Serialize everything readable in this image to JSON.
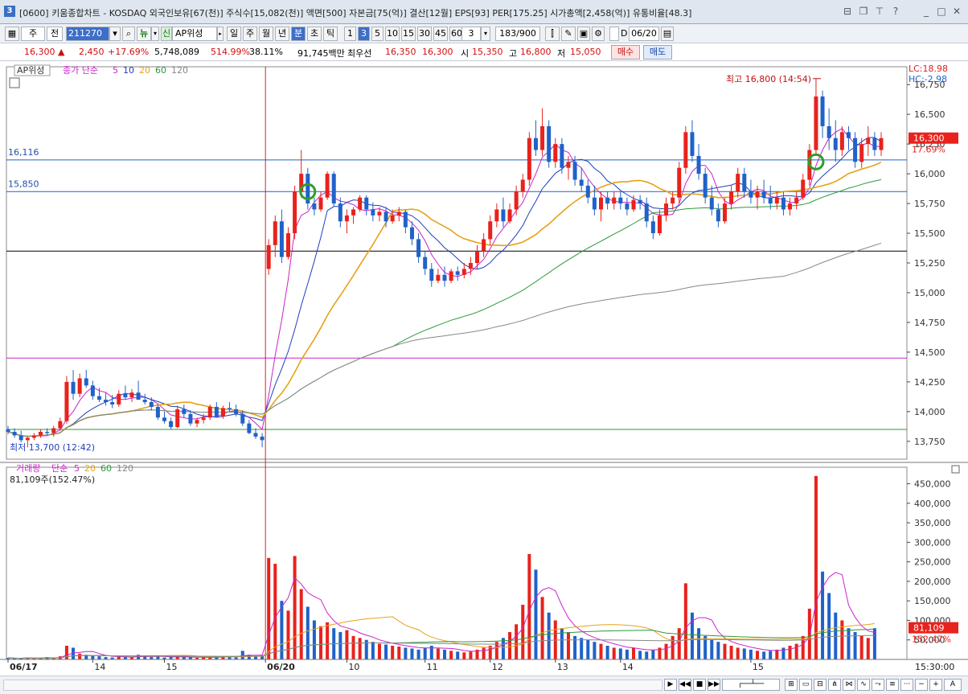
{
  "title": {
    "text": "[0600] 키움종합차트 - KOSDAQ 외국인보유[67(천)] 주식수[15,082(천)] 액면[500] 자본금[75(억)] 결산[12월] EPS[93] PER[175.25] 시가총액[2,458(억)] 유통비율[48.3]",
    "icon": "3"
  },
  "toolbar": {
    "mode": "주",
    "kind": "전",
    "code": "211270",
    "search_icon": "search-icon",
    "news": "뉴",
    "sin": "신",
    "name": "AP위성",
    "periods": [
      "일",
      "주",
      "월",
      "년",
      "분",
      "초",
      "틱"
    ],
    "selected_period": "분",
    "intervals": [
      "1",
      "3",
      "5",
      "10",
      "15",
      "30",
      "45",
      "60"
    ],
    "selected_interval": "3",
    "interval_value": "3",
    "count": "183/900",
    "date_check": "D",
    "date": "06/20"
  },
  "quote": {
    "price": "16,300 ▲",
    "change": "2,450",
    "change_rate": "+17.69%",
    "volume": "5,748,089",
    "vol_rate": "514.99%",
    "turnover": "38.11%",
    "amount": "91,745백만",
    "best_label": "최우선",
    "ask": "16,350",
    "bid": "16,300",
    "open_label": "시",
    "open": "15,350",
    "high_label": "고",
    "high": "16,800",
    "low_label": "저",
    "low": "15,050",
    "buy": "매수",
    "sell": "매도"
  },
  "price_panel": {
    "stock_tag": "AP위성",
    "legend": {
      "label": "종가 단순",
      "periods": [
        "5",
        "10",
        "20",
        "60",
        "120"
      ]
    },
    "lc": "LC:18.98",
    "hc": "HC:-2.98",
    "high_annot": "최고 16,800 (14:54)",
    "low_annot": "최저 13,700 (12:42)",
    "hline_labels": [
      "16,116",
      "15,850"
    ],
    "last_price": "16,300",
    "last_rate": "17.69%",
    "y_ticks": [
      "16,750",
      "16,500",
      "16,250",
      "16,000",
      "15,750",
      "15,500",
      "15,250",
      "15,000",
      "14,750",
      "14,500",
      "14,250",
      "14,000",
      "13,750"
    ]
  },
  "volume_panel": {
    "legend": {
      "label": "거래량",
      "sub": "단순",
      "periods": [
        "5",
        "20",
        "60",
        "120"
      ]
    },
    "value_label": "81,109주(152.47%)",
    "last_volume": "81,109",
    "last_rate": "152.47%",
    "y_ticks": [
      "450,000",
      "400,000",
      "350,000",
      "300,000",
      "250,000",
      "200,000",
      "150,000",
      "100,000",
      "50,000"
    ]
  },
  "x_axis": {
    "labels": [
      "06/17",
      "14",
      "15",
      "06/20",
      "10",
      "11",
      "12",
      "13",
      "14",
      "15"
    ],
    "time_label": "15:30:00"
  },
  "colors": {
    "up": "#e8221c",
    "down": "#1f62c9",
    "ma5": "#cc22cc",
    "ma10": "#1f3fbf",
    "ma20": "#e6a21a",
    "ma60": "#2a9a3a",
    "ma120": "#888888"
  },
  "chart_data": {
    "type": "candlestick",
    "ylim": [
      13600,
      16900
    ],
    "vol_ylim": [
      0,
      480000
    ],
    "hlines": [
      16116,
      15850,
      15350,
      14450,
      13850
    ],
    "ohlc": [
      [
        13850,
        13880,
        13810,
        13830
      ],
      [
        13830,
        13860,
        13780,
        13800
      ],
      [
        13800,
        13840,
        13740,
        13760
      ],
      [
        13760,
        13790,
        13700,
        13780
      ],
      [
        13780,
        13820,
        13760,
        13800
      ],
      [
        13800,
        13850,
        13780,
        13830
      ],
      [
        13830,
        13860,
        13800,
        13820
      ],
      [
        13820,
        13880,
        13790,
        13860
      ],
      [
        13860,
        13950,
        13840,
        13920
      ],
      [
        13920,
        14300,
        13900,
        14250
      ],
      [
        14250,
        14350,
        14100,
        14150
      ],
      [
        14150,
        14320,
        14120,
        14280
      ],
      [
        14280,
        14350,
        14200,
        14220
      ],
      [
        14220,
        14260,
        14100,
        14130
      ],
      [
        14130,
        14200,
        14080,
        14100
      ],
      [
        14100,
        14160,
        14050,
        14080
      ],
      [
        14080,
        14140,
        14030,
        14060
      ],
      [
        14060,
        14180,
        14040,
        14150
      ],
      [
        14150,
        14220,
        14100,
        14120
      ],
      [
        14120,
        14190,
        14080,
        14160
      ],
      [
        14160,
        14260,
        14140,
        14100
      ],
      [
        14100,
        14150,
        14060,
        14080
      ],
      [
        14080,
        14120,
        14010,
        14040
      ],
      [
        14040,
        14060,
        13930,
        13950
      ],
      [
        13950,
        14000,
        13900,
        13920
      ],
      [
        13920,
        13950,
        13850,
        13870
      ],
      [
        13870,
        14050,
        13860,
        14020
      ],
      [
        14020,
        14060,
        13950,
        13980
      ],
      [
        13980,
        14010,
        13880,
        13900
      ],
      [
        13900,
        13950,
        13870,
        13930
      ],
      [
        13930,
        13980,
        13900,
        13950
      ],
      [
        13950,
        14060,
        13930,
        14040
      ],
      [
        14040,
        14080,
        13950,
        13960
      ],
      [
        13960,
        14050,
        13940,
        14030
      ],
      [
        14030,
        14080,
        14000,
        14020
      ],
      [
        14020,
        14060,
        13960,
        13980
      ],
      [
        13980,
        14010,
        13880,
        13900
      ],
      [
        13900,
        13930,
        13810,
        13820
      ],
      [
        13820,
        13860,
        13770,
        13790
      ],
      [
        13790,
        13820,
        13700,
        13760
      ],
      [
        15200,
        15450,
        15150,
        15400
      ],
      [
        15400,
        15650,
        15300,
        15600
      ],
      [
        15600,
        15700,
        15250,
        15300
      ],
      [
        15300,
        15550,
        15280,
        15500
      ],
      [
        15500,
        15900,
        15450,
        15850
      ],
      [
        15850,
        16200,
        15800,
        16000
      ],
      [
        16000,
        16050,
        15700,
        15750
      ],
      [
        15750,
        15800,
        15650,
        15700
      ],
      [
        15700,
        15850,
        15680,
        15800
      ],
      [
        15800,
        16020,
        15780,
        16000
      ],
      [
        16000,
        16020,
        15720,
        15750
      ],
      [
        15750,
        15800,
        15550,
        15600
      ],
      [
        15600,
        15700,
        15500,
        15650
      ],
      [
        15650,
        15720,
        15580,
        15700
      ],
      [
        15700,
        15820,
        15680,
        15800
      ],
      [
        15800,
        15820,
        15650,
        15700
      ],
      [
        15700,
        15760,
        15600,
        15650
      ],
      [
        15650,
        15720,
        15600,
        15680
      ],
      [
        15680,
        15720,
        15550,
        15600
      ],
      [
        15600,
        15700,
        15580,
        15650
      ],
      [
        15650,
        15720,
        15600,
        15680
      ],
      [
        15680,
        15700,
        15500,
        15550
      ],
      [
        15550,
        15600,
        15400,
        15450
      ],
      [
        15450,
        15500,
        15250,
        15300
      ],
      [
        15300,
        15350,
        15150,
        15200
      ],
      [
        15200,
        15250,
        15050,
        15100
      ],
      [
        15100,
        15200,
        15080,
        15150
      ],
      [
        15150,
        15220,
        15050,
        15100
      ],
      [
        15100,
        15200,
        15080,
        15180
      ],
      [
        15180,
        15220,
        15100,
        15150
      ],
      [
        15150,
        15250,
        15120,
        15200
      ],
      [
        15200,
        15300,
        15150,
        15250
      ],
      [
        15250,
        15400,
        15200,
        15350
      ],
      [
        15350,
        15500,
        15300,
        15450
      ],
      [
        15450,
        15650,
        15400,
        15600
      ],
      [
        15600,
        15750,
        15550,
        15700
      ],
      [
        15700,
        15800,
        15550,
        15600
      ],
      [
        15600,
        15750,
        15580,
        15700
      ],
      [
        15700,
        15900,
        15650,
        15850
      ],
      [
        15850,
        16000,
        15800,
        15950
      ],
      [
        15950,
        16350,
        15900,
        16300
      ],
      [
        16300,
        16450,
        16150,
        16200
      ],
      [
        16200,
        16550,
        16150,
        16400
      ],
      [
        16400,
        16450,
        16050,
        16100
      ],
      [
        16100,
        16300,
        16050,
        16250
      ],
      [
        16250,
        16300,
        16000,
        16050
      ],
      [
        16050,
        16150,
        15950,
        16100
      ],
      [
        16100,
        16150,
        15900,
        15950
      ],
      [
        15950,
        16050,
        15850,
        15900
      ],
      [
        15900,
        15950,
        15750,
        15800
      ],
      [
        15800,
        15900,
        15650,
        15700
      ],
      [
        15700,
        15850,
        15600,
        15800
      ],
      [
        15800,
        15850,
        15700,
        15750
      ],
      [
        15750,
        15850,
        15700,
        15800
      ],
      [
        15800,
        15850,
        15700,
        15750
      ],
      [
        15750,
        15800,
        15650,
        15700
      ],
      [
        15700,
        15820,
        15680,
        15780
      ],
      [
        15780,
        15820,
        15700,
        15750
      ],
      [
        15750,
        15800,
        15550,
        15600
      ],
      [
        15600,
        15650,
        15450,
        15500
      ],
      [
        15500,
        15700,
        15480,
        15650
      ],
      [
        15650,
        15800,
        15600,
        15750
      ],
      [
        15750,
        15850,
        15700,
        15800
      ],
      [
        15800,
        16100,
        15750,
        16050
      ],
      [
        16050,
        16400,
        16000,
        16350
      ],
      [
        16350,
        16450,
        16100,
        16150
      ],
      [
        16150,
        16250,
        15950,
        16000
      ],
      [
        16000,
        16050,
        15750,
        15800
      ],
      [
        15800,
        15900,
        15650,
        15700
      ],
      [
        15700,
        15750,
        15550,
        15600
      ],
      [
        15600,
        15800,
        15580,
        15750
      ],
      [
        15750,
        15900,
        15700,
        15850
      ],
      [
        15850,
        16050,
        15800,
        16000
      ],
      [
        16000,
        16050,
        15800,
        15850
      ],
      [
        15850,
        15950,
        15750,
        15800
      ],
      [
        15800,
        15900,
        15700,
        15850
      ],
      [
        15850,
        15950,
        15750,
        15800
      ],
      [
        15800,
        15900,
        15700,
        15750
      ],
      [
        15750,
        15850,
        15700,
        15800
      ],
      [
        15800,
        15850,
        15650,
        15700
      ],
      [
        15700,
        15800,
        15650,
        15750
      ],
      [
        15750,
        15850,
        15700,
        15800
      ],
      [
        15800,
        16000,
        15780,
        15950
      ],
      [
        15950,
        16250,
        15900,
        16200
      ],
      [
        16200,
        16800,
        16150,
        16650
      ],
      [
        16650,
        16700,
        16300,
        16400
      ],
      [
        16400,
        16550,
        16200,
        16300
      ],
      [
        16300,
        16450,
        16100,
        16200
      ],
      [
        16200,
        16400,
        16150,
        16350
      ],
      [
        16350,
        16400,
        16200,
        16300
      ],
      [
        16300,
        16350,
        16050,
        16100
      ],
      [
        16100,
        16300,
        16050,
        16250
      ],
      [
        16250,
        16400,
        16150,
        16300
      ],
      [
        16300,
        16350,
        16150,
        16200
      ],
      [
        16200,
        16350,
        16150,
        16300
      ]
    ],
    "volume": [
      4000,
      2500,
      3000,
      5000,
      2000,
      3500,
      6000,
      3000,
      8000,
      35000,
      30000,
      15000,
      12000,
      10000,
      8000,
      6000,
      5000,
      7000,
      6000,
      5000,
      12000,
      8000,
      6000,
      7000,
      5000,
      6000,
      8000,
      6000,
      5000,
      4000,
      5000,
      6000,
      7000,
      8000,
      6000,
      5000,
      22000,
      12000,
      8000,
      10000,
      260000,
      245000,
      150000,
      125000,
      265000,
      180000,
      135000,
      100000,
      85000,
      95000,
      80000,
      70000,
      75000,
      60000,
      55000,
      50000,
      45000,
      40000,
      38000,
      35000,
      33000,
      30000,
      28000,
      25000,
      30000,
      35000,
      28000,
      25000,
      22000,
      20000,
      18000,
      20000,
      25000,
      30000,
      35000,
      45000,
      55000,
      70000,
      90000,
      140000,
      270000,
      230000,
      160000,
      120000,
      100000,
      80000,
      70000,
      60000,
      55000,
      50000,
      45000,
      40000,
      35000,
      30000,
      28000,
      25000,
      30000,
      22000,
      20000,
      25000,
      30000,
      40000,
      60000,
      80000,
      195000,
      120000,
      80000,
      60000,
      50000,
      45000,
      40000,
      35000,
      30000,
      28000,
      25000,
      22000,
      20000,
      22000,
      25000,
      30000,
      35000,
      40000,
      60000,
      130000,
      470000,
      225000,
      170000,
      120000,
      100000,
      80000,
      70000,
      60000,
      55000,
      80000
    ]
  }
}
